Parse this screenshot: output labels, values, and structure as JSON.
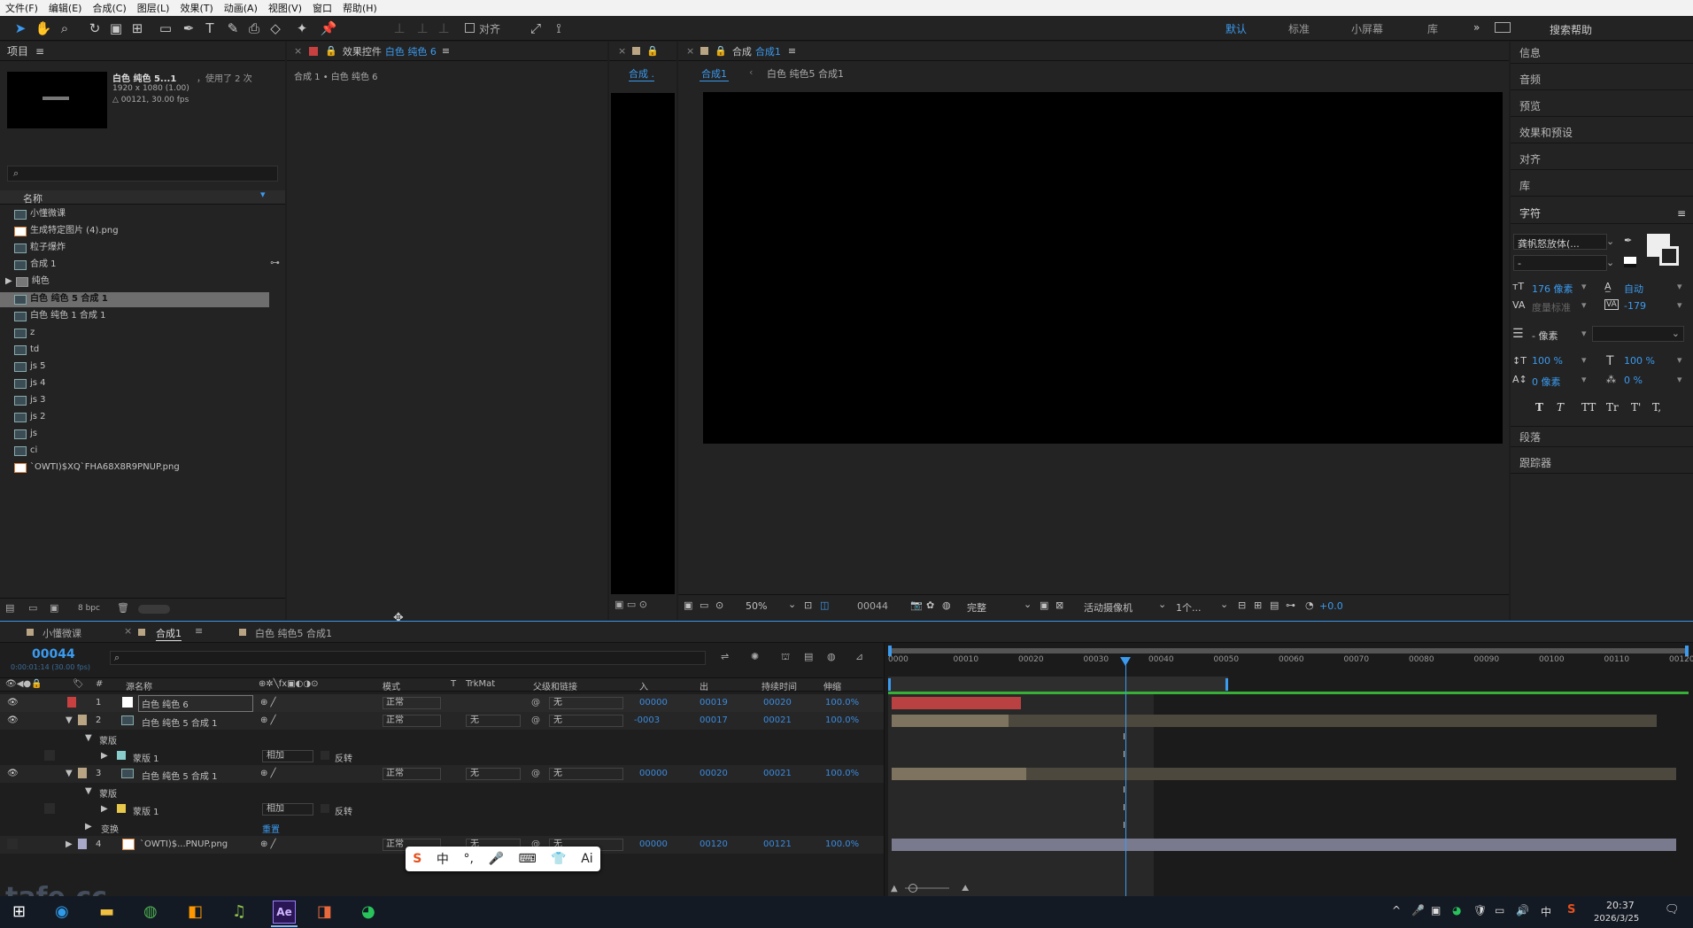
{
  "menu": [
    "文件(F)",
    "编辑(E)",
    "合成(C)",
    "图层(L)",
    "效果(T)",
    "动画(A)",
    "视图(V)",
    "窗口",
    "帮助(H)"
  ],
  "toolbar": {
    "align_label": "对齐",
    "workspaces": [
      "默认",
      "标准",
      "小屏幕",
      "库"
    ],
    "search_placeholder": "搜索帮助"
  },
  "project": {
    "title": "项目",
    "selected_name": "白色 纯色 5...1",
    "used": "，使用了 2 次",
    "dims": "1920 x 1080 (1.00)",
    "duration": "△ 00121, 30.00 fps",
    "column_name": "名称",
    "bpc": "8 bpc",
    "items": [
      "小懂微课",
      "生成特定图片 (4).png",
      "粒子爆炸",
      "合成 1",
      "纯色",
      "白色 纯色 5 合成 1",
      "白色 纯色 1 合成 1",
      "z",
      "td",
      "js 5",
      "js 4",
      "js 3",
      "js 2",
      "js",
      "ci",
      "`OWTI)$XQ`FHA68X8R9PNUP.png"
    ]
  },
  "effects": {
    "title": "效果控件",
    "target": "白色 纯色 6",
    "breadcrumb": "合成 1 • 白色 纯色 6"
  },
  "comp_small": {
    "tab": "合成 ."
  },
  "comp_main": {
    "title": "合成",
    "name": "合成1",
    "tab1": "合成1",
    "tab2": "白色 纯色5 合成1",
    "zoom": "50%",
    "time": "00044",
    "quality": "完整",
    "camera": "活动摄像机",
    "views": "1个...",
    "exposure": "+0.0"
  },
  "right_panels": [
    "信息",
    "音频",
    "预览",
    "效果和预设",
    "对齐",
    "库"
  ],
  "character": {
    "title": "字符",
    "font": "龚帆怒放体(...",
    "style": "-",
    "size": "176 像素",
    "leading": "自动",
    "kerning": "度量标准",
    "tracking": "-179",
    "stroke": "- 像素",
    "vscale": "100 %",
    "hscale": "100 %",
    "baseline": "0 像素",
    "tsume": "0 %",
    "styles": [
      "T",
      "T",
      "TT",
      "Tr",
      "T'",
      "T,"
    ]
  },
  "bottom_panels": [
    "段落",
    "跟踪器"
  ],
  "timeline": {
    "tabs": [
      "小懂微课",
      "合成1",
      "白色 纯色5 合成1"
    ],
    "timecode": "00044",
    "fps_info": "0:00:01:14 (30.00 fps)",
    "headers": {
      "num": "#",
      "source": "源名称",
      "mode": "模式",
      "t": "T",
      "trkmat": "TrkMat",
      "parent": "父级和链接",
      "in": "入",
      "out": "出",
      "dur": "持续时间",
      "stretch": "伸缩"
    },
    "ruler": [
      "0000",
      "00010",
      "00020",
      "00030",
      "00040",
      "00050",
      "00060",
      "00070",
      "00080",
      "00090",
      "00100",
      "00110",
      "00120"
    ],
    "layers": [
      {
        "num": "1",
        "name": "白色 纯色 6",
        "mode": "正常",
        "trk": "",
        "parent": "无",
        "in": "00000",
        "out": "00019",
        "dur": "00020",
        "stretch": "100.0%",
        "color": "#c84040"
      },
      {
        "num": "2",
        "name": "白色 纯色 5 合成 1",
        "mode": "正常",
        "trk": "无",
        "parent": "无",
        "in": "-0003",
        "out": "00017",
        "dur": "00021",
        "stretch": "100.0%",
        "color": "#b9a483"
      },
      {
        "num": "3",
        "name": "白色 纯色 5 合成 1",
        "mode": "正常",
        "trk": "无",
        "parent": "无",
        "in": "00000",
        "out": "00020",
        "dur": "00021",
        "stretch": "100.0%",
        "color": "#b9a483"
      },
      {
        "num": "4",
        "name": "`OWTI)$...PNUP.png",
        "mode": "正常",
        "trk": "无",
        "parent": "无",
        "in": "00000",
        "out": "00120",
        "dur": "00121",
        "stretch": "100.0%",
        "color": "#a8a8c8"
      }
    ],
    "mask_group": "蒙版",
    "mask1": "蒙版 1",
    "add": "相加",
    "invert": "反转",
    "transform": "变换",
    "reset": "重置"
  },
  "ime": [
    "S",
    "中",
    "°,",
    "🎤",
    "⌨",
    "👕",
    "Ai"
  ],
  "taskbar": {
    "time": "20:37",
    "date": "2026/3/25",
    "ime": "中"
  },
  "watermark": "tafe.cc"
}
